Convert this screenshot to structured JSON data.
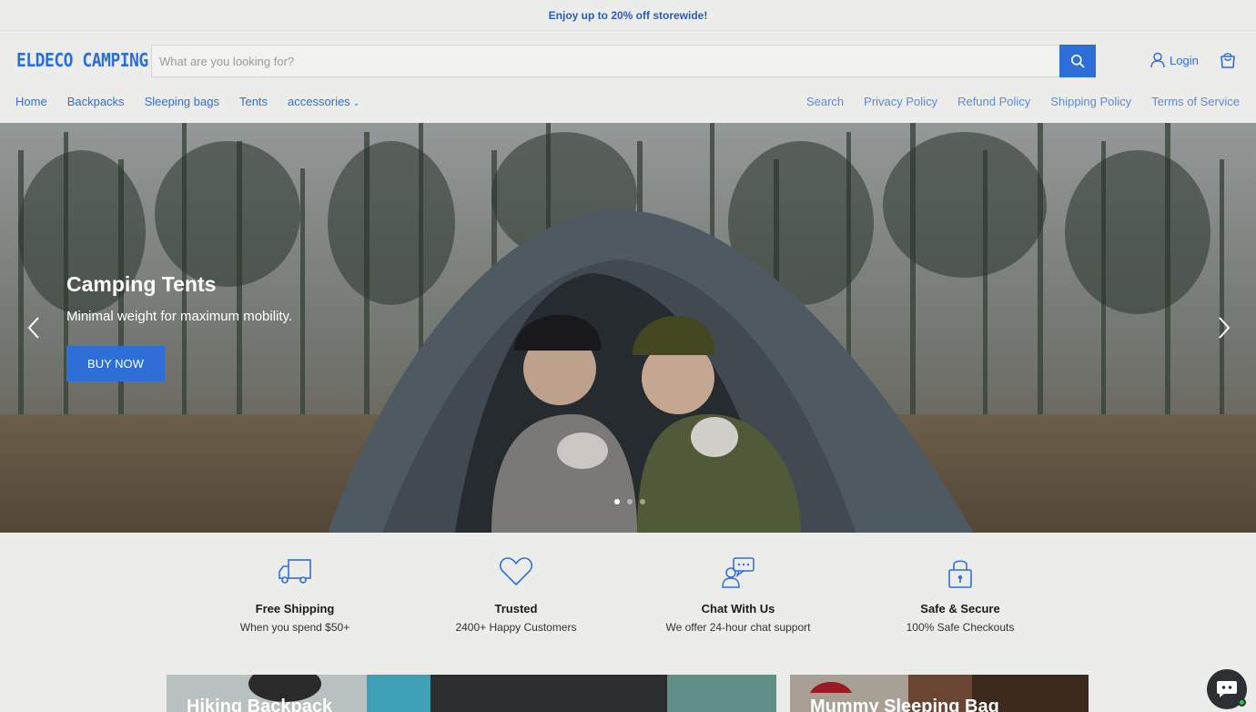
{
  "announcement": "Enjoy up to 20% off storewide!",
  "header": {
    "logo": "ELDECO CAMPING",
    "search_placeholder": "What are you looking for?",
    "login_label": "Login"
  },
  "nav": {
    "left": [
      "Home",
      "Backpacks",
      "Sleeping bags",
      "Tents",
      "accessories"
    ],
    "right": [
      "Search",
      "Privacy Policy",
      "Refund Policy",
      "Shipping Policy",
      "Terms of Service"
    ]
  },
  "hero": {
    "title": "Camping Tents",
    "subtitle": "Minimal weight for maximum mobility.",
    "button": "BUY NOW",
    "slide_count": 3,
    "active_slide": 1
  },
  "features": [
    {
      "icon": "truck-icon",
      "title": "Free Shipping",
      "subtitle": "When you spend $50+"
    },
    {
      "icon": "heart-icon",
      "title": "Trusted",
      "subtitle": "2400+ Happy Customers"
    },
    {
      "icon": "chat-person-icon",
      "title": "Chat With Us",
      "subtitle": "We offer 24-hour chat support"
    },
    {
      "icon": "lock-icon",
      "title": "Safe & Secure",
      "subtitle": "100% Safe Checkouts"
    }
  ],
  "promos": [
    {
      "title": "Hiking Backpack"
    },
    {
      "title": "Mummy Sleeping Bag"
    }
  ],
  "colors": {
    "accent": "#2d6fd6",
    "background": "#ececea"
  }
}
